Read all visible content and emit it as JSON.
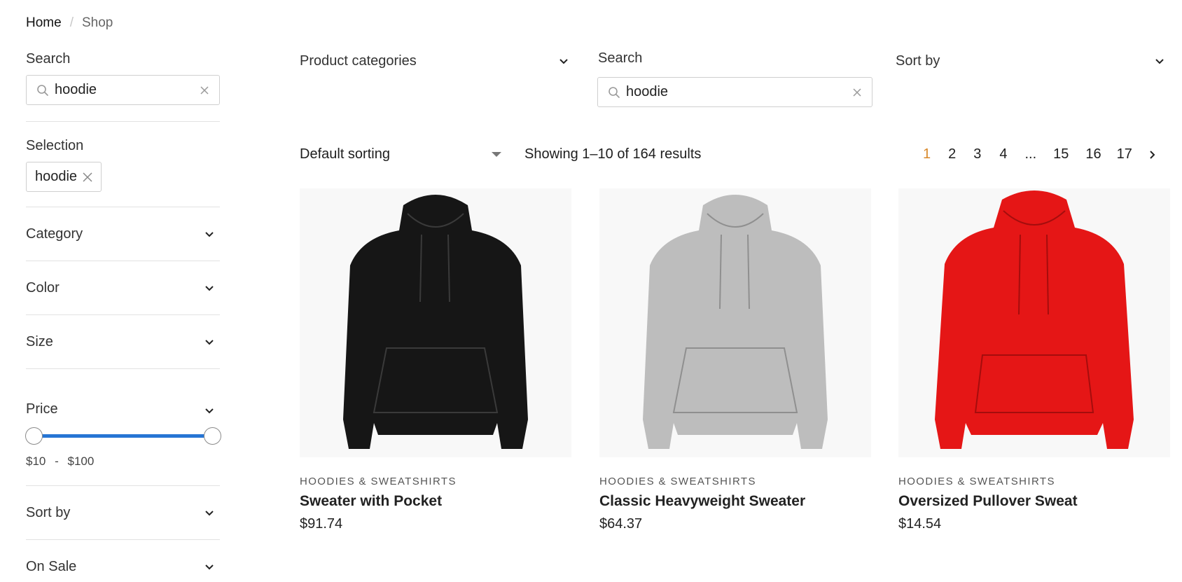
{
  "breadcrumb": {
    "home": "Home",
    "separator": "/",
    "current": "Shop"
  },
  "sidebar": {
    "search": {
      "label": "Search",
      "value": "hoodie"
    },
    "selection": {
      "label": "Selection",
      "chip": "hoodie"
    },
    "filters": {
      "category": "Category",
      "color": "Color",
      "size": "Size",
      "price": "Price",
      "sort_by": "Sort by",
      "on_sale": "On Sale"
    },
    "price_range": {
      "min": "$10",
      "dash": "-",
      "max": "$100",
      "min_value": 10,
      "max_value": 100
    }
  },
  "top_filters": {
    "product_categories": "Product categories",
    "search_label": "Search",
    "search_value": "hoodie",
    "sort_by": "Sort by"
  },
  "toolbar": {
    "sorting": "Default sorting",
    "results": "Showing 1–10 of 164 results"
  },
  "pagination": {
    "current": "1",
    "pages": [
      "2",
      "3",
      "4"
    ],
    "ellipsis": "...",
    "last_pages": [
      "15",
      "16",
      "17"
    ]
  },
  "products": [
    {
      "category": "HOODIES & SWEATSHIRTS",
      "name": "Sweater with Pocket",
      "price": "$91.74",
      "color": "#161616",
      "image_icon": "black-hoodie-image"
    },
    {
      "category": "HOODIES & SWEATSHIRTS",
      "name": "Classic Heavyweight Sweater",
      "price": "$64.37",
      "color": "#bdbdbd",
      "image_icon": "gray-hoodie-image"
    },
    {
      "category": "HOODIES & SWEATSHIRTS",
      "name": "Oversized Pullover Sweat",
      "price": "$14.54",
      "color": "#e51616",
      "image_icon": "red-hoodie-image"
    }
  ],
  "colors": {
    "accent": "#2675d4",
    "active_page": "#d9892b"
  }
}
